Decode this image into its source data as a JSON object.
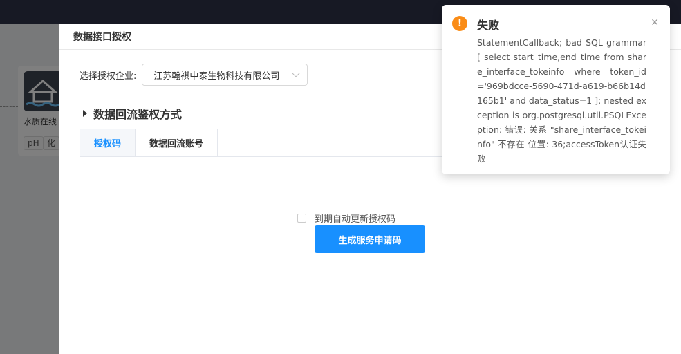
{
  "background": {
    "card_title": "水质在线",
    "tags": [
      "pH",
      "化"
    ]
  },
  "dialog": {
    "title": "数据接口授权",
    "close_icon": "close-icon",
    "company_label": "选择授权企业:",
    "company_value": "江苏翰祺中泰生物科技有限公司",
    "section_title": "数据回流鉴权方式",
    "tabs": [
      {
        "label": "授权码",
        "active": true
      },
      {
        "label": "数据回流账号",
        "active": false
      }
    ],
    "auto_renew_label": "到期自动更新授权码",
    "generate_button": "生成服务申请码"
  },
  "notification": {
    "type": "warning",
    "icon_symbol": "!",
    "title": "失败",
    "close_symbol": "✕",
    "message": "StatementCallback; bad SQL grammar [ select start_time,end_time from share_interface_tokeinfo where token_id='969bdcce-5690-471d-a619-b66b14d165b1' and data_status=1 ]; nested exception is org.postgresql.util.PSQLException: 错误: 关系 \"share_interface_tokeinfo\" 不存在 位置: 36;accessToken认证失败"
  },
  "colors": {
    "primary": "#1890ff",
    "warning": "#fa8c16",
    "topbar": "#2f3348"
  }
}
